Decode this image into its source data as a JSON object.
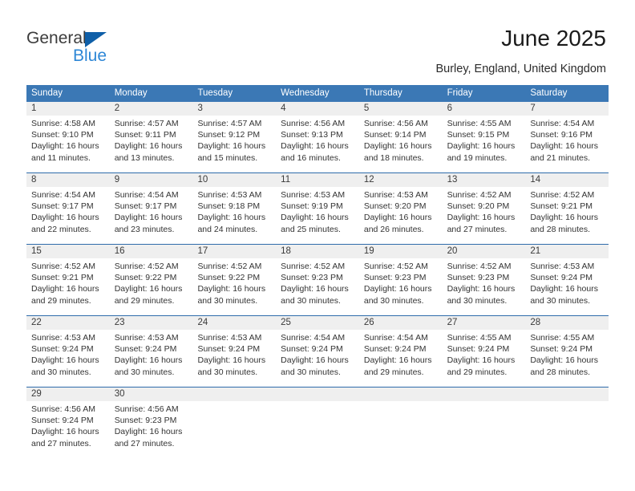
{
  "logo": {
    "word_top": "General",
    "word_bottom": "Blue",
    "triangle_color": "#0f5fa8",
    "blue_color": "#2e87d6"
  },
  "header": {
    "title": "June 2025",
    "subtitle": "Burley, England, United Kingdom"
  },
  "theme": {
    "header_blue": "#3b78b5",
    "row_rule_blue": "#2f6cab",
    "daynum_band": "#efefef"
  },
  "calendar": {
    "weekdays": [
      "Sunday",
      "Monday",
      "Tuesday",
      "Wednesday",
      "Thursday",
      "Friday",
      "Saturday"
    ],
    "weeks": [
      {
        "days": [
          {
            "num": "1",
            "lines": [
              "Sunrise: 4:58 AM",
              "Sunset: 9:10 PM",
              "Daylight: 16 hours",
              "and 11 minutes."
            ]
          },
          {
            "num": "2",
            "lines": [
              "Sunrise: 4:57 AM",
              "Sunset: 9:11 PM",
              "Daylight: 16 hours",
              "and 13 minutes."
            ]
          },
          {
            "num": "3",
            "lines": [
              "Sunrise: 4:57 AM",
              "Sunset: 9:12 PM",
              "Daylight: 16 hours",
              "and 15 minutes."
            ]
          },
          {
            "num": "4",
            "lines": [
              "Sunrise: 4:56 AM",
              "Sunset: 9:13 PM",
              "Daylight: 16 hours",
              "and 16 minutes."
            ]
          },
          {
            "num": "5",
            "lines": [
              "Sunrise: 4:56 AM",
              "Sunset: 9:14 PM",
              "Daylight: 16 hours",
              "and 18 minutes."
            ]
          },
          {
            "num": "6",
            "lines": [
              "Sunrise: 4:55 AM",
              "Sunset: 9:15 PM",
              "Daylight: 16 hours",
              "and 19 minutes."
            ]
          },
          {
            "num": "7",
            "lines": [
              "Sunrise: 4:54 AM",
              "Sunset: 9:16 PM",
              "Daylight: 16 hours",
              "and 21 minutes."
            ]
          }
        ]
      },
      {
        "days": [
          {
            "num": "8",
            "lines": [
              "Sunrise: 4:54 AM",
              "Sunset: 9:17 PM",
              "Daylight: 16 hours",
              "and 22 minutes."
            ]
          },
          {
            "num": "9",
            "lines": [
              "Sunrise: 4:54 AM",
              "Sunset: 9:17 PM",
              "Daylight: 16 hours",
              "and 23 minutes."
            ]
          },
          {
            "num": "10",
            "lines": [
              "Sunrise: 4:53 AM",
              "Sunset: 9:18 PM",
              "Daylight: 16 hours",
              "and 24 minutes."
            ]
          },
          {
            "num": "11",
            "lines": [
              "Sunrise: 4:53 AM",
              "Sunset: 9:19 PM",
              "Daylight: 16 hours",
              "and 25 minutes."
            ]
          },
          {
            "num": "12",
            "lines": [
              "Sunrise: 4:53 AM",
              "Sunset: 9:20 PM",
              "Daylight: 16 hours",
              "and 26 minutes."
            ]
          },
          {
            "num": "13",
            "lines": [
              "Sunrise: 4:52 AM",
              "Sunset: 9:20 PM",
              "Daylight: 16 hours",
              "and 27 minutes."
            ]
          },
          {
            "num": "14",
            "lines": [
              "Sunrise: 4:52 AM",
              "Sunset: 9:21 PM",
              "Daylight: 16 hours",
              "and 28 minutes."
            ]
          }
        ]
      },
      {
        "days": [
          {
            "num": "15",
            "lines": [
              "Sunrise: 4:52 AM",
              "Sunset: 9:21 PM",
              "Daylight: 16 hours",
              "and 29 minutes."
            ]
          },
          {
            "num": "16",
            "lines": [
              "Sunrise: 4:52 AM",
              "Sunset: 9:22 PM",
              "Daylight: 16 hours",
              "and 29 minutes."
            ]
          },
          {
            "num": "17",
            "lines": [
              "Sunrise: 4:52 AM",
              "Sunset: 9:22 PM",
              "Daylight: 16 hours",
              "and 30 minutes."
            ]
          },
          {
            "num": "18",
            "lines": [
              "Sunrise: 4:52 AM",
              "Sunset: 9:23 PM",
              "Daylight: 16 hours",
              "and 30 minutes."
            ]
          },
          {
            "num": "19",
            "lines": [
              "Sunrise: 4:52 AM",
              "Sunset: 9:23 PM",
              "Daylight: 16 hours",
              "and 30 minutes."
            ]
          },
          {
            "num": "20",
            "lines": [
              "Sunrise: 4:52 AM",
              "Sunset: 9:23 PM",
              "Daylight: 16 hours",
              "and 30 minutes."
            ]
          },
          {
            "num": "21",
            "lines": [
              "Sunrise: 4:53 AM",
              "Sunset: 9:24 PM",
              "Daylight: 16 hours",
              "and 30 minutes."
            ]
          }
        ]
      },
      {
        "days": [
          {
            "num": "22",
            "lines": [
              "Sunrise: 4:53 AM",
              "Sunset: 9:24 PM",
              "Daylight: 16 hours",
              "and 30 minutes."
            ]
          },
          {
            "num": "23",
            "lines": [
              "Sunrise: 4:53 AM",
              "Sunset: 9:24 PM",
              "Daylight: 16 hours",
              "and 30 minutes."
            ]
          },
          {
            "num": "24",
            "lines": [
              "Sunrise: 4:53 AM",
              "Sunset: 9:24 PM",
              "Daylight: 16 hours",
              "and 30 minutes."
            ]
          },
          {
            "num": "25",
            "lines": [
              "Sunrise: 4:54 AM",
              "Sunset: 9:24 PM",
              "Daylight: 16 hours",
              "and 30 minutes."
            ]
          },
          {
            "num": "26",
            "lines": [
              "Sunrise: 4:54 AM",
              "Sunset: 9:24 PM",
              "Daylight: 16 hours",
              "and 29 minutes."
            ]
          },
          {
            "num": "27",
            "lines": [
              "Sunrise: 4:55 AM",
              "Sunset: 9:24 PM",
              "Daylight: 16 hours",
              "and 29 minutes."
            ]
          },
          {
            "num": "28",
            "lines": [
              "Sunrise: 4:55 AM",
              "Sunset: 9:24 PM",
              "Daylight: 16 hours",
              "and 28 minutes."
            ]
          }
        ]
      },
      {
        "days": [
          {
            "num": "29",
            "lines": [
              "Sunrise: 4:56 AM",
              "Sunset: 9:24 PM",
              "Daylight: 16 hours",
              "and 27 minutes."
            ]
          },
          {
            "num": "30",
            "lines": [
              "Sunrise: 4:56 AM",
              "Sunset: 9:23 PM",
              "Daylight: 16 hours",
              "and 27 minutes."
            ]
          },
          {
            "num": "",
            "lines": []
          },
          {
            "num": "",
            "lines": []
          },
          {
            "num": "",
            "lines": []
          },
          {
            "num": "",
            "lines": []
          },
          {
            "num": "",
            "lines": []
          }
        ]
      }
    ]
  }
}
